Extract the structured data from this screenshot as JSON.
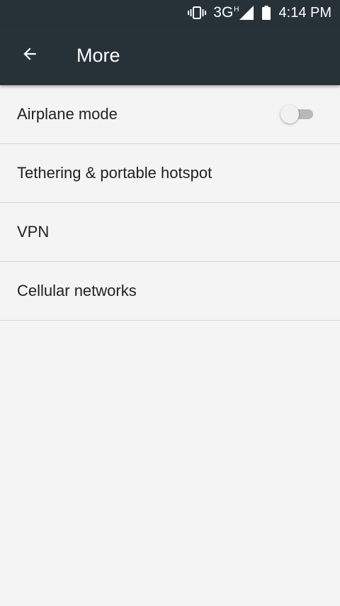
{
  "status_bar": {
    "vibrate_icon": "vibrate-icon",
    "network_type": "3G",
    "network_sup": "H",
    "signal_icon": "signal-strength-icon",
    "battery_icon": "battery-icon",
    "time": "4:14 PM"
  },
  "toolbar": {
    "back_icon": "arrow-back-icon",
    "title": "More",
    "background": "#263238"
  },
  "settings": {
    "items": [
      {
        "label": "Airplane mode",
        "toggle": {
          "on": false
        }
      },
      {
        "label": "Tethering & portable hotspot"
      },
      {
        "label": "VPN"
      },
      {
        "label": "Cellular networks"
      }
    ]
  },
  "colors": {
    "page_background": "#f4f4f4",
    "divider": "#d7d7d7",
    "text_primary": "#212121"
  }
}
